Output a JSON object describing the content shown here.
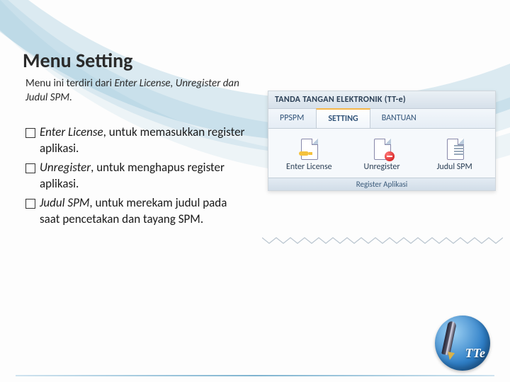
{
  "page": {
    "title": "Menu Setting"
  },
  "subtitle": {
    "lead": "Menu ini terdiri dari ",
    "items": "Enter License, Unregister dan Judul SPM.",
    "tail": ""
  },
  "bullets": [
    {
      "term": "Enter License",
      "rest": ", untuk memasukkan register aplikasi."
    },
    {
      "term": "Unregister",
      "rest": ", untuk menghapus register aplikasi."
    },
    {
      "term": "Judul SPM",
      "rest": ", untuk merekam judul pada saat pencetakan dan tayang SPM."
    }
  ],
  "app": {
    "title": "TANDA TANGAN ELEKTRONIK (TT-e)",
    "tabs": [
      {
        "label": "PPSPM",
        "active": false
      },
      {
        "label": "SETTING",
        "active": true
      },
      {
        "label": "BANTUAN",
        "active": false
      }
    ],
    "buttons": [
      {
        "label": "Enter License"
      },
      {
        "label": "Unregister"
      },
      {
        "label": "Judul SPM"
      }
    ],
    "group_label": "Register Aplikasi"
  },
  "logo": {
    "text": "TTe"
  }
}
